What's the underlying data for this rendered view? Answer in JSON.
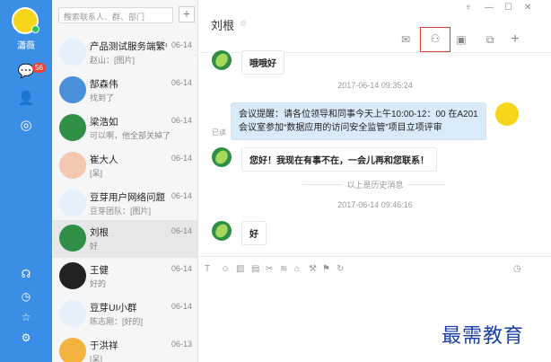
{
  "user": {
    "name": "瀟薇"
  },
  "rail": {
    "unread_count": "56"
  },
  "search": {
    "placeholder": "搜索联系人、群、部门"
  },
  "conversations": [
    {
      "name": "产品测试服务端繁餐...",
      "time": "06-14",
      "preview": "赵山：[图片]",
      "avatar_color": "#e6f0fa"
    },
    {
      "name": "郜森伟",
      "time": "06-14",
      "preview": "找到了",
      "avatar_color": "#4a90d9"
    },
    {
      "name": "梁浩如",
      "time": "06-14",
      "preview": "可以啊，他全部关掉了",
      "avatar_color": "#2f8f46"
    },
    {
      "name": "崔大人",
      "time": "06-14",
      "preview": "[呆]",
      "avatar_color": "#f2c8b0"
    },
    {
      "name": "豆芽用户网络问题",
      "time": "06-14",
      "preview": "豆芽团队：[图片]",
      "avatar_color": "#e6f0fa"
    },
    {
      "name": "刘根",
      "time": "06-14",
      "preview": "好",
      "avatar_color": "#2f8f46"
    },
    {
      "name": "王健",
      "time": "06-14",
      "preview": "好的",
      "avatar_color": "#222222"
    },
    {
      "name": "豆芽UI小群",
      "time": "06-14",
      "preview": "陈志刚：[好的]",
      "avatar_color": "#e6f0fa"
    },
    {
      "name": "于洪祥",
      "time": "06-13",
      "preview": "[呆]",
      "avatar_color": "#f2b341"
    }
  ],
  "chat": {
    "title": "刘根",
    "messages": {
      "m1": "哦哦好",
      "ts1": "2017-06-14 09:35:24",
      "m2": "会议提醒：请各位领导和同事今天上午10:00-12：00 在A201会议室参加“数据应用的访问安全监管”项目立项评审",
      "read_label": "已读",
      "m3": "您好！我现在有事不在，一会儿再和您联系！",
      "history_label": "以上是历史消息",
      "ts2": "2017-06-14 09:46:16",
      "m4": "好"
    }
  },
  "watermark": "最需教育",
  "colors": {
    "rail": "#3a8ee6",
    "highlight": "#e23b3b",
    "bubble_mine": "#d9ebfb"
  }
}
